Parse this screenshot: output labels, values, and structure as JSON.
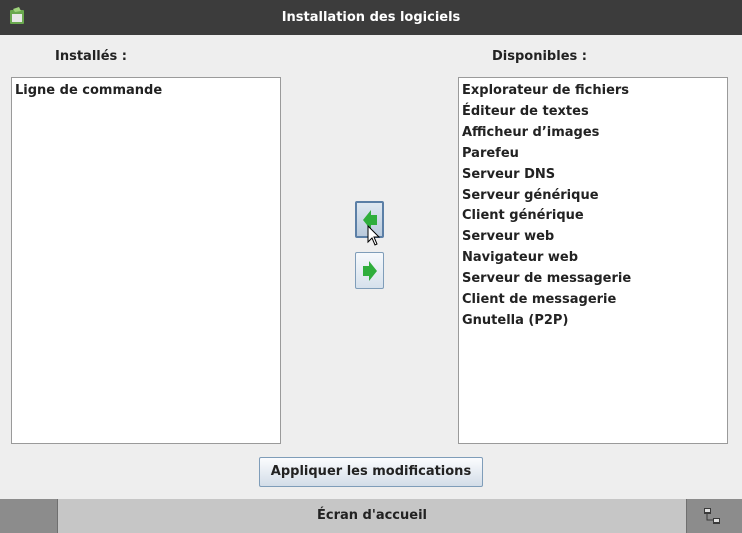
{
  "window": {
    "title": "Installation des logiciels",
    "icon": "app-icon"
  },
  "installed": {
    "label": "Installés :",
    "items": [
      "Ligne de commande"
    ]
  },
  "available": {
    "label": "Disponibles :",
    "items": [
      "Explorateur de fichiers",
      "Éditeur de textes",
      "Afficheur d’images",
      "Parefeu",
      "Serveur DNS",
      "Serveur générique",
      "Client générique",
      "Serveur web",
      "Navigateur web",
      "Serveur de messagerie",
      "Client de messagerie",
      "Gnutella (P2P)"
    ]
  },
  "transfer": {
    "install_icon": "arrow-left-icon",
    "uninstall_icon": "arrow-right-icon",
    "arrow_color": "#2eae3c"
  },
  "apply_button": {
    "label": "Appliquer les modifications"
  },
  "bottombar": {
    "home_label": "Écran d'accueil",
    "icon": "network-icon"
  },
  "colors": {
    "titlebar": "#3c3c3c",
    "background": "#eeeeee",
    "bottombar": "#8c8c8c"
  }
}
